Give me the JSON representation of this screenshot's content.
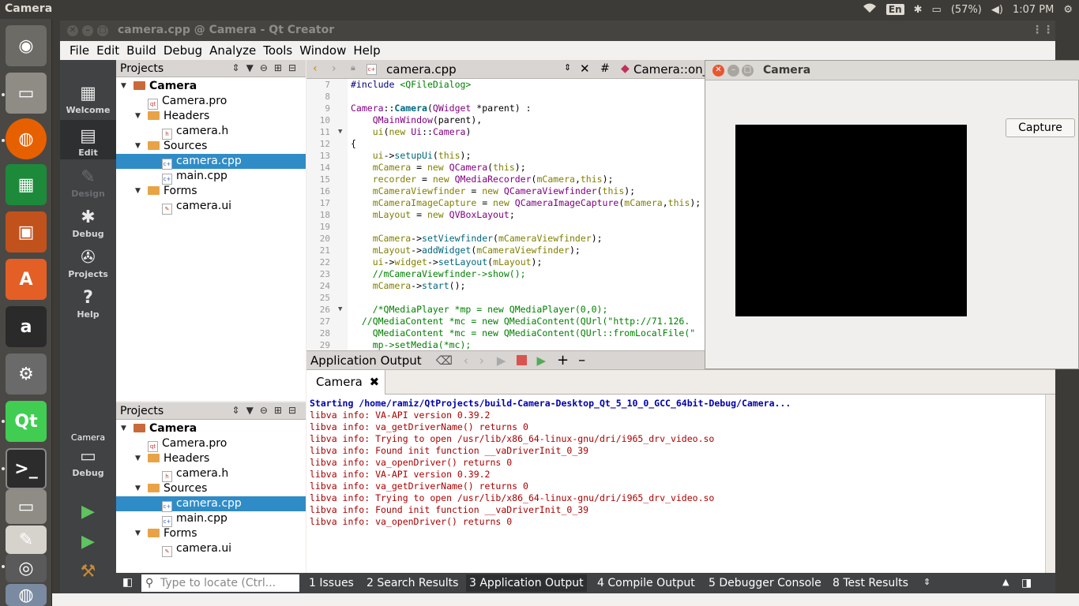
{
  "topbar": {
    "app_name": "Camera",
    "battery": "(57%)",
    "time": "1:07 PM",
    "kbd": "En"
  },
  "window": {
    "title": "camera.cpp @ Camera - Qt Creator"
  },
  "menu": [
    "File",
    "Edit",
    "Build",
    "Debug",
    "Analyze",
    "Tools",
    "Window",
    "Help"
  ],
  "modes": {
    "welcome": "Welcome",
    "edit": "Edit",
    "design": "Design",
    "debug": "Debug",
    "projects": "Projects",
    "help": "Help",
    "kit_name": "Camera",
    "kit_mode": "Debug"
  },
  "projects": {
    "header": "Projects",
    "root": "Camera",
    "pro": "Camera.pro",
    "headers": "Headers",
    "header_file": "camera.h",
    "sources": "Sources",
    "src1": "camera.cpp",
    "src2": "main.cpp",
    "forms": "Forms",
    "form_file": "camera.ui"
  },
  "editor": {
    "file": "camera.cpp",
    "hash": "#",
    "symbol": "Camera::on_c",
    "line_numbers": [
      "7",
      "8",
      "9",
      "10",
      "11",
      "12",
      "13",
      "14",
      "15",
      "16",
      "17",
      "18",
      "19",
      "20",
      "21",
      "22",
      "23",
      "24",
      "25",
      "26",
      "27",
      "28",
      "29"
    ]
  },
  "output": {
    "title": "Application Output",
    "tab": "Camera",
    "start_line": "Starting /home/ramiz/QtProjects/build-Camera-Desktop_Qt_5_10_0_GCC_64bit-Debug/Camera...",
    "lines": [
      "libva info: VA-API version 0.39.2",
      "libva info: va_getDriverName() returns 0",
      "libva info: Trying to open /usr/lib/x86_64-linux-gnu/dri/i965_drv_video.so",
      "libva info: Found init function __vaDriverInit_0_39",
      "libva info: va_openDriver() returns 0",
      "libva info: VA-API version 0.39.2",
      "libva info: va_getDriverName() returns 0",
      "libva info: Trying to open /usr/lib/x86_64-linux-gnu/dri/i965_drv_video.so",
      "libva info: Found init function __vaDriverInit_0_39",
      "libva info: va_openDriver() returns 0"
    ]
  },
  "status": {
    "locator_placeholder": "Type to locate (Ctrl...",
    "tabs": [
      "1  Issues",
      "2  Search Results",
      "3  Application Output",
      "4  Compile Output",
      "5  Debugger Console",
      "8  Test Results"
    ]
  },
  "camera_app": {
    "title": "Camera",
    "capture": "Capture"
  },
  "colors": {
    "selection": "#308cc6",
    "mode_bar": "#404244",
    "ubuntu_panel": "#3c3b37"
  }
}
